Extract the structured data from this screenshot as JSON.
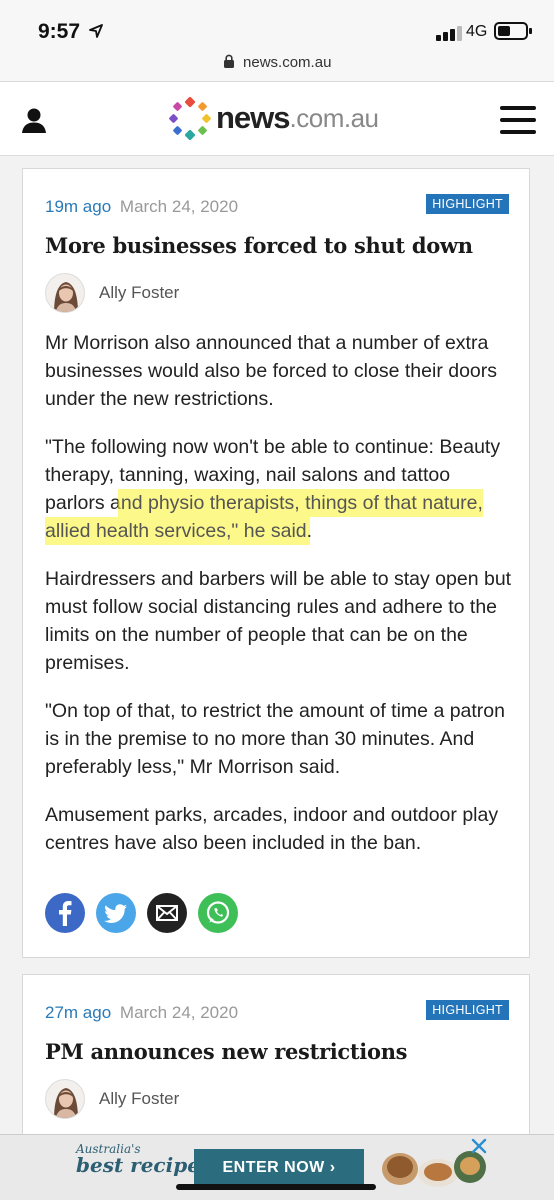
{
  "status_bar": {
    "time": "9:57",
    "network": "4G",
    "battery_percent": 45
  },
  "url_bar": {
    "url": "news.com.au"
  },
  "header": {
    "logo_primary": "news",
    "logo_secondary": ".com.au"
  },
  "articles": [
    {
      "time_ago": "19m ago",
      "date": "March 24, 2020",
      "badge": "HIGHLIGHT",
      "headline": "More businesses forced to shut down",
      "author": "Ally Foster",
      "paragraphs": [
        "Mr Morrison also announced that a number of extra businesses would also be forced to close their doors under the new restrictions.",
        "Hairdressers and barbers will be able to stay open but must follow social distancing rules and adhere to the limits on the number of people that can be on the premises.",
        "\"On top of that, to restrict the amount of time a patron is in the premise to no more than 30 minutes. And preferably less,\" Mr Morrison said.",
        "Amusement parks, arcades, indoor and outdoor play centres have also been included in the ban."
      ],
      "quote": {
        "before": "\"The following now won't be able to continue: Beauty therapy, tanning, waxing, nail salons and tattoo parlors a",
        "highlighted": "nd physio therapists, things of that nature, allied health services,\" he said",
        "after": "."
      }
    },
    {
      "time_ago": "27m ago",
      "date": "March 24, 2020",
      "badge": "HIGHLIGHT",
      "headline": "PM announces new restrictions",
      "author": "Ally Foster"
    }
  ],
  "share_icons": [
    "facebook-icon",
    "twitter-icon",
    "email-icon",
    "whatsapp-icon"
  ],
  "ad": {
    "brand_small": "Australia's",
    "brand_big": "best recipes",
    "cta": "ENTER NOW ›"
  },
  "colors": {
    "link_blue": "#2a7ab8",
    "badge_blue": "#2474b9",
    "highlight_yellow": "#faf53c"
  }
}
